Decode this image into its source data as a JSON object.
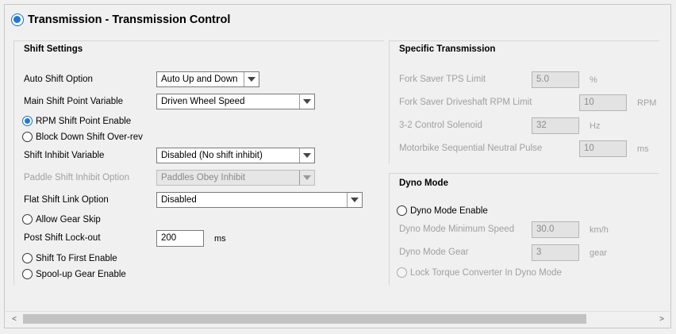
{
  "title": "Transmission - Transmission Control",
  "shift_settings": {
    "title": "Shift Settings",
    "auto_shift_option": {
      "label": "Auto Shift Option",
      "value": "Auto Up and Down"
    },
    "main_shift_point_variable": {
      "label": "Main Shift Point Variable",
      "value": "Driven Wheel Speed"
    },
    "rpm_shift_point_enable": {
      "label": "RPM Shift Point Enable",
      "checked": true
    },
    "block_down_shift_overrev": {
      "label": "Block Down Shift Over-rev",
      "checked": false
    },
    "shift_inhibit_variable": {
      "label": "Shift Inhibit Variable",
      "value": "Disabled (No shift inhibit)"
    },
    "paddle_shift_inhibit_option": {
      "label": "Paddle Shift Inhibit Option",
      "value": "Paddles Obey Inhibit",
      "disabled": true
    },
    "flat_shift_link_option": {
      "label": "Flat Shift Link Option",
      "value": "Disabled"
    },
    "allow_gear_skip": {
      "label": "Allow Gear Skip",
      "checked": false
    },
    "post_shift_lockout": {
      "label": "Post Shift Lock-out",
      "value": "200",
      "unit": "ms"
    },
    "shift_to_first_enable": {
      "label": "Shift To First Enable",
      "checked": false
    },
    "spoolup_gear_enable": {
      "label": "Spool-up Gear Enable",
      "checked": false
    }
  },
  "specific_transmission": {
    "title": "Specific Transmission",
    "fork_saver_tps_limit": {
      "label": "Fork Saver TPS Limit",
      "value": "5.0",
      "unit": "%"
    },
    "fork_saver_driveshaft_rpm_limit": {
      "label": "Fork Saver Driveshaft RPM Limit",
      "value": "10",
      "unit": "RPM"
    },
    "control_solenoid_32": {
      "label": "3-2 Control Solenoid",
      "value": "32",
      "unit": "Hz"
    },
    "motorbike_neutral_pulse": {
      "label": "Motorbike Sequential Neutral Pulse",
      "value": "10",
      "unit": "ms"
    }
  },
  "dyno_mode": {
    "title": "Dyno Mode",
    "enable": {
      "label": "Dyno Mode Enable",
      "checked": false
    },
    "minimum_speed": {
      "label": "Dyno Mode Minimum Speed",
      "value": "30.0",
      "unit": "km/h"
    },
    "gear": {
      "label": "Dyno Mode Gear",
      "value": "3",
      "unit": "gear"
    },
    "lock_torque_converter": {
      "label": "Lock Torque Converter In Dyno Mode",
      "checked": false
    }
  },
  "scrollbar": {
    "left_arrow": "<",
    "right_arrow": ">"
  },
  "colors": {
    "accent": "#1e7ad6",
    "disabled_text": "#a0a0a0"
  }
}
